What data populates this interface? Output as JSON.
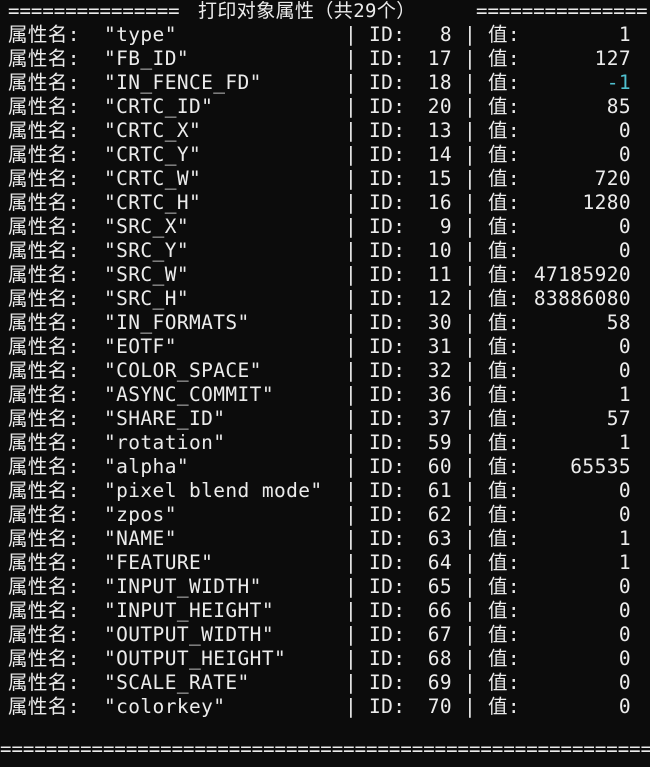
{
  "title": "打印对象属性（共29个）",
  "header_fill_left": "===============",
  "header_fill_right": "===============",
  "footer_fill": "==========================================================",
  "label_text": "属性名:",
  "id_label": "ID:",
  "value_label": "值:",
  "separator": "|",
  "highlight_color": "#4fc0cf",
  "rows": [
    {
      "name": "\"type\"",
      "id": "8",
      "value": "1"
    },
    {
      "name": "\"FB_ID\"",
      "id": "17",
      "value": "127"
    },
    {
      "name": "\"IN_FENCE_FD\"",
      "id": "18",
      "value": "-1",
      "highlight": true
    },
    {
      "name": "\"CRTC_ID\"",
      "id": "20",
      "value": "85"
    },
    {
      "name": "\"CRTC_X\"",
      "id": "13",
      "value": "0"
    },
    {
      "name": "\"CRTC_Y\"",
      "id": "14",
      "value": "0"
    },
    {
      "name": "\"CRTC_W\"",
      "id": "15",
      "value": "720"
    },
    {
      "name": "\"CRTC_H\"",
      "id": "16",
      "value": "1280"
    },
    {
      "name": "\"SRC_X\"",
      "id": "9",
      "value": "0"
    },
    {
      "name": "\"SRC_Y\"",
      "id": "10",
      "value": "0"
    },
    {
      "name": "\"SRC_W\"",
      "id": "11",
      "value": "47185920"
    },
    {
      "name": "\"SRC_H\"",
      "id": "12",
      "value": "83886080"
    },
    {
      "name": "\"IN_FORMATS\"",
      "id": "30",
      "value": "58"
    },
    {
      "name": "\"EOTF\"",
      "id": "31",
      "value": "0"
    },
    {
      "name": "\"COLOR_SPACE\"",
      "id": "32",
      "value": "0"
    },
    {
      "name": "\"ASYNC_COMMIT\"",
      "id": "36",
      "value": "1"
    },
    {
      "name": "\"SHARE_ID\"",
      "id": "37",
      "value": "57"
    },
    {
      "name": "\"rotation\"",
      "id": "59",
      "value": "1"
    },
    {
      "name": "\"alpha\"",
      "id": "60",
      "value": "65535"
    },
    {
      "name": "\"pixel blend mode\"",
      "id": "61",
      "value": "0"
    },
    {
      "name": "\"zpos\"",
      "id": "62",
      "value": "0"
    },
    {
      "name": "\"NAME\"",
      "id": "63",
      "value": "1"
    },
    {
      "name": "\"FEATURE\"",
      "id": "64",
      "value": "1"
    },
    {
      "name": "\"INPUT_WIDTH\"",
      "id": "65",
      "value": "0"
    },
    {
      "name": "\"INPUT_HEIGHT\"",
      "id": "66",
      "value": "0"
    },
    {
      "name": "\"OUTPUT_WIDTH\"",
      "id": "67",
      "value": "0"
    },
    {
      "name": "\"OUTPUT_HEIGHT\"",
      "id": "68",
      "value": "0"
    },
    {
      "name": "\"SCALE_RATE\"",
      "id": "69",
      "value": "0"
    },
    {
      "name": "\"colorkey\"",
      "id": "70",
      "value": "0"
    }
  ]
}
